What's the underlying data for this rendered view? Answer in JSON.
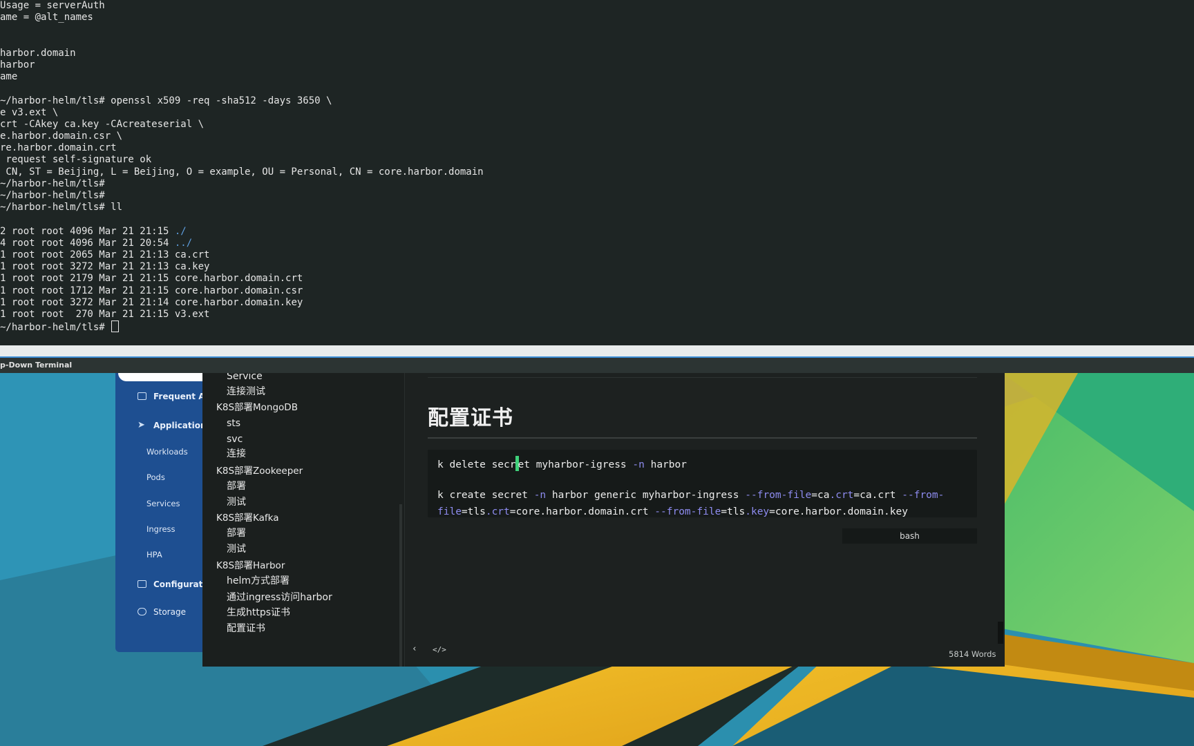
{
  "terminal": {
    "lines": [
      "Usage = serverAuth",
      "ame = @alt_names",
      "",
      "",
      "harbor.domain",
      "harbor",
      "ame",
      "",
      "~/harbor-helm/tls# openssl x509 -req -sha512 -days 3650 \\",
      "e v3.ext \\",
      "crt -CAkey ca.key -CAcreateserial \\",
      "e.harbor.domain.csr \\",
      "re.harbor.domain.crt",
      " request self-signature ok",
      " CN, ST = Beijing, L = Beijing, O = example, OU = Personal, CN = core.harbor.domain",
      "~/harbor-helm/tls#",
      "~/harbor-helm/tls#",
      "~/harbor-helm/tls# ll",
      ""
    ],
    "listing": [
      {
        "meta": "2 root root 4096 Mar 21 21:15 ",
        "name": "./",
        "is_dir": true
      },
      {
        "meta": "4 root root 4096 Mar 21 20:54 ",
        "name": "../",
        "is_dir": true
      },
      {
        "meta": "1 root root 2065 Mar 21 21:13 ",
        "name": "ca.crt",
        "is_dir": false
      },
      {
        "meta": "1 root root 3272 Mar 21 21:13 ",
        "name": "ca.key",
        "is_dir": false
      },
      {
        "meta": "1 root root 2179 Mar 21 21:15 ",
        "name": "core.harbor.domain.crt",
        "is_dir": false
      },
      {
        "meta": "1 root root 1712 Mar 21 21:15 ",
        "name": "core.harbor.domain.csr",
        "is_dir": false
      },
      {
        "meta": "1 root root 3272 Mar 21 21:14 ",
        "name": "core.harbor.domain.key",
        "is_dir": false
      },
      {
        "meta": "1 root root  270 Mar 21 21:15 ",
        "name": "v3.ext",
        "is_dir": false
      }
    ],
    "final_prompt": "~/harbor-helm/tls# ",
    "window_title": "p-Down Terminal"
  },
  "app_nav": {
    "frequent": "Frequent Act",
    "applications": "Applications",
    "workloads": "Workloads",
    "pods": "Pods",
    "services": "Services",
    "ingress": "Ingress",
    "hpa": "HPA",
    "configuration": "Configuration",
    "storage": "Storage"
  },
  "outline": [
    {
      "text": "Service",
      "level": 2
    },
    {
      "text": "连接测试",
      "level": 2
    },
    {
      "text": "K8S部署MongoDB",
      "level": 1
    },
    {
      "text": "sts",
      "level": 2
    },
    {
      "text": "svc",
      "level": 2
    },
    {
      "text": "连接",
      "level": 2
    },
    {
      "text": "K8S部署Zookeeper",
      "level": 1
    },
    {
      "text": "部署",
      "level": 2
    },
    {
      "text": "测试",
      "level": 2
    },
    {
      "text": "K8S部署Kafka",
      "level": 1
    },
    {
      "text": "部署",
      "level": 2
    },
    {
      "text": "测试",
      "level": 2
    },
    {
      "text": "K8S部署Harbor",
      "level": 1
    },
    {
      "text": "helm方式部署",
      "level": 2
    },
    {
      "text": "通过ingress访问harbor",
      "level": 2
    },
    {
      "text": "生成https证书",
      "level": 2
    },
    {
      "text": "配置证书",
      "level": 2
    }
  ],
  "editor": {
    "heading": "配置证书",
    "code_language": "bash",
    "word_count": "5814 Words",
    "code": {
      "line1_a": "k delete secr",
      "line1_b": "et myharbor-i",
      "line1_c": "gress ",
      "line1_flag": "-n",
      "line1_d": " harbor",
      "line2_a": "k create secret ",
      "line2_flag": "-n",
      "line2_b": " harbor generic myharbor-ingress ",
      "line2_opt1": "--from-file",
      "line2_c": "=ca",
      "line2_p1": ".crt",
      "line2_d": "=ca.crt ",
      "line2_opt2": "--from-",
      "line3_opt": "file",
      "line3_a": "=tls",
      "line3_p1": ".crt",
      "line3_b": "=core.harbor.domain.crt ",
      "line3_opt2": "--from-file",
      "line3_c": "=tls",
      "line3_p2": ".key",
      "line3_d": "=core.harbor.domain.key"
    }
  },
  "colors": {
    "terminal_bg": "#1e2524",
    "dir_blue": "#5f9fe0",
    "sidebar_blue": "#1e4f91",
    "code_keyword": "#8e8cf0",
    "caret_green": "#3fd17a"
  }
}
